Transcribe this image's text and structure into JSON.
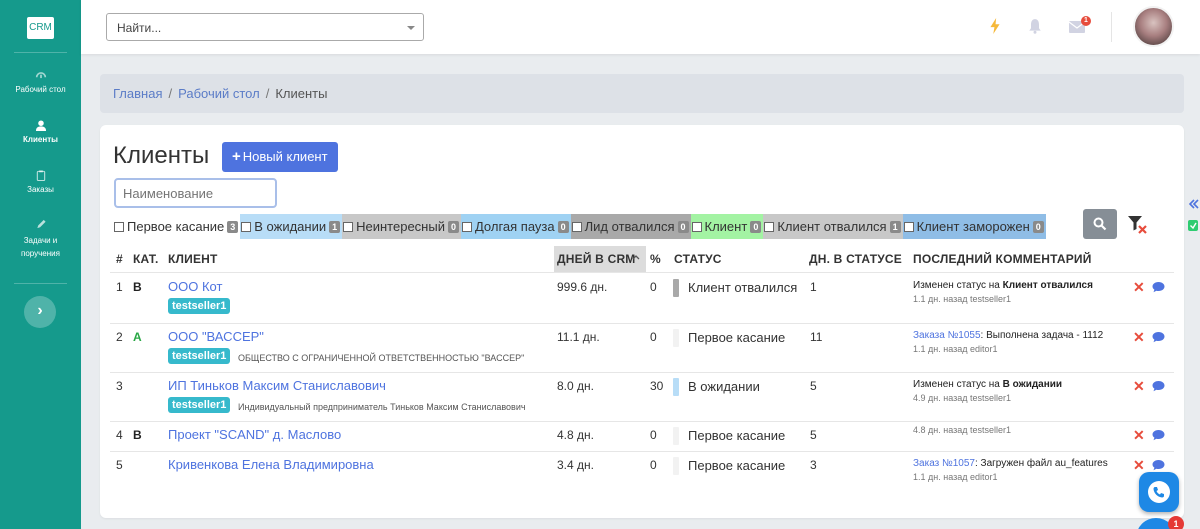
{
  "sidebar": {
    "logo": "CRM",
    "items": [
      {
        "label": "Рабочий стол",
        "icon": "dashboard-icon",
        "active": false
      },
      {
        "label": "Клиенты",
        "icon": "user-icon",
        "active": true
      },
      {
        "label": "Заказы",
        "icon": "clipboard-icon",
        "active": false
      },
      {
        "label": "Задачи и поручения",
        "icon": "pen-icon",
        "active": false
      }
    ],
    "collapse_glyph": "›"
  },
  "topbar": {
    "search_placeholder": "Найти...",
    "mail_badge": "1"
  },
  "breadcrumb": {
    "items": [
      "Главная",
      "Рабочий стол",
      "Клиенты"
    ],
    "separator": "/"
  },
  "page": {
    "title": "Клиенты",
    "new_button": "Новый клиент",
    "name_placeholder": "Наименование"
  },
  "filters": [
    {
      "label": "Первое касание",
      "count": "3",
      "bg": "#ffffff"
    },
    {
      "label": "В ожидании",
      "count": "1",
      "bg": "#b8ddf7"
    },
    {
      "label": "Неинтересный",
      "count": "0",
      "bg": "#c8c8c8"
    },
    {
      "label": "Долгая пауза",
      "count": "0",
      "bg": "#9fd2f3"
    },
    {
      "label": "Лид отвалился",
      "count": "0",
      "bg": "#a9a9a9"
    },
    {
      "label": "Клиент",
      "count": "0",
      "bg": "#a3f3a3"
    },
    {
      "label": "Клиент отвалился",
      "count": "1",
      "bg": "#c8c8c8"
    },
    {
      "label": "Клиент заморожен",
      "count": "0",
      "bg": "#8fbde6"
    }
  ],
  "table": {
    "headers": {
      "num": "#",
      "cat": "КАТ.",
      "client": "КЛИЕНТ",
      "days": "ДНЕЙ В CRM",
      "pct": "%",
      "status": "СТАТУС",
      "days_status": "ДН. В СТАТУСЕ",
      "last_comment": "ПОСЛЕДНИЙ КОММЕНТАРИЙ"
    },
    "rows": [
      {
        "num": "1",
        "cat": "B",
        "client": "ООО Кот",
        "seller": "testseller1",
        "full_name": "",
        "days": "999.6 дн.",
        "pct": "0",
        "status": "Клиент отвалился",
        "status_color": "#a9a9a9",
        "days_status": "1",
        "comment_prefix": "Изменен статус на ",
        "comment_bold": "Клиент отвалился",
        "comment_link": "",
        "comment_rest": "",
        "comment_meta": "1.1 дн. назад testseller1"
      },
      {
        "num": "2",
        "cat": "A",
        "client": "ООО \"ВАССЕР\"",
        "seller": "testseller1",
        "full_name": "ОБЩЕСТВО С ОГРАНИЧЕННОЙ ОТВЕТСТВЕННОСТЬЮ \"ВАССЕР\"",
        "days": "11.1 дн.",
        "pct": "0",
        "status": "Первое касание",
        "status_color": "#f2f2f2",
        "days_status": "11",
        "comment_prefix": "",
        "comment_bold": "",
        "comment_link": "Заказа №1055",
        "comment_rest": ": Выполнена задача - 1112",
        "comment_meta": "1.1 дн. назад editor1"
      },
      {
        "num": "3",
        "cat": "",
        "client": "ИП Тиньков Максим Станиславович",
        "seller": "testseller1",
        "full_name": "Индивидуальный предприниматель Тиньков Максим Станиславович",
        "days": "8.0 дн.",
        "pct": "30",
        "status": "В ожидании",
        "status_color": "#b8ddf7",
        "days_status": "5",
        "comment_prefix": "Изменен статус на ",
        "comment_bold": "В ожидании",
        "comment_link": "",
        "comment_rest": "",
        "comment_meta": "4.9 дн. назад testseller1"
      },
      {
        "num": "4",
        "cat": "B",
        "client": "Проект \"SCAND\" д. Маслово",
        "seller": "",
        "full_name": "",
        "days": "4.8 дн.",
        "pct": "0",
        "status": "Первое касание",
        "status_color": "#f2f2f2",
        "days_status": "5",
        "comment_prefix": "",
        "comment_bold": "",
        "comment_link": "",
        "comment_rest": "",
        "comment_meta": "4.8 дн. назад testseller1"
      },
      {
        "num": "5",
        "cat": "",
        "client": "Кривенкова Елена Владимировна",
        "seller": "",
        "full_name": "",
        "days": "3.4 дн.",
        "pct": "0",
        "status": "Первое касание",
        "status_color": "#f2f2f2",
        "days_status": "3",
        "comment_prefix": "",
        "comment_bold": "",
        "comment_link": "Заказ №1057",
        "comment_rest": ": Загружен файл au_features",
        "comment_meta": "1.1 дн. назад editor1"
      }
    ],
    "delete_glyph": "✕"
  },
  "floating": {
    "badge": "1"
  },
  "colors": {
    "sidebar": "#159a8c",
    "primary": "#4e73df",
    "seller_tag": "#36b9cc",
    "danger": "#e74c3c",
    "cat_a": "#28a745"
  }
}
